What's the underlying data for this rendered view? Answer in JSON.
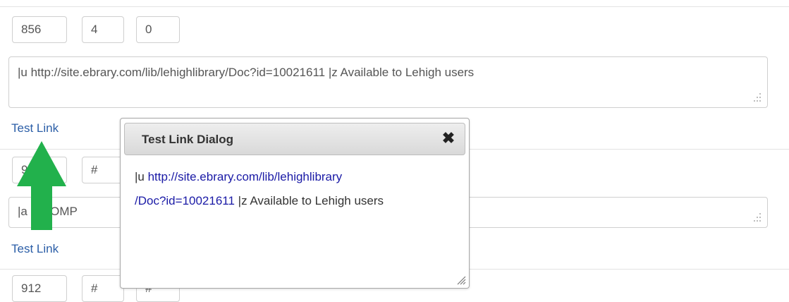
{
  "field1": {
    "tag": "856",
    "ind1": "4",
    "ind2": "0",
    "subfields": "|u http://site.ebrary.com/lib/lehighlibrary/Doc?id=10021611 |z Available to Lehigh users",
    "test_link": "Test Link"
  },
  "field2": {
    "tag": "9",
    "ind1": "#",
    "subfields_visible": "|a",
    "subfields_tail": "COMP",
    "test_link": "Test Link"
  },
  "field3": {
    "tag": "912",
    "ind1": "#",
    "ind2": "#"
  },
  "dialog": {
    "title": "Test Link Dialog",
    "close_icon": "close-icon",
    "prefix": "|u ",
    "link_line1": "http://site.ebrary.com/lib/lehighlibrary",
    "link_line2": "/Doc?id=10021611",
    "suffix": " |z Available to Lehigh users"
  },
  "annotation": {
    "arrow_icon": "up-arrow-icon",
    "arrow_color": "#22b14c"
  },
  "colors": {
    "link": "#2b5ea7",
    "dialog_link": "#1a1aa6"
  }
}
